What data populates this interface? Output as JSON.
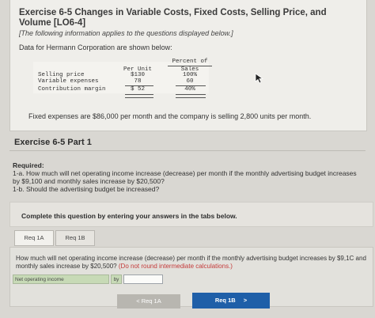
{
  "exercise": {
    "title": "Exercise 6-5 Changes in Variable Costs, Fixed Costs, Selling Price, and Volume [LO6-4]",
    "note": "[The following information applies to the questions displayed below.]",
    "intro": "Data for Hermann Corporation are shown below:",
    "table": {
      "col_per_unit": "Per Unit",
      "col_percent_of": "Percent of",
      "col_sales": "Sales",
      "rows": [
        {
          "label": "Selling price",
          "per_unit": "$130",
          "percent": "100%"
        },
        {
          "label": "Variable expenses",
          "per_unit": "78",
          "percent": "60"
        },
        {
          "label": "Contribution margin",
          "per_unit": "$ 52",
          "percent": "40%"
        }
      ]
    },
    "fixed_note": "Fixed expenses are $86,000 per month and the company is selling 2,800 units per month."
  },
  "part": {
    "title": "Exercise 6-5 Part 1",
    "required_label": "Required:",
    "required_1a": "1-a. How much will net operating income increase (decrease) per month if the monthly advertising budget increases by $9,100 and monthly sales increase by $20,500?",
    "required_1b": "1-b. Should the advertising budget be increased?"
  },
  "banner": {
    "text": "Complete this question by entering your answers in the tabs below."
  },
  "tabs": [
    {
      "label": "Req 1A",
      "active": true
    },
    {
      "label": "Req 1B",
      "active": false
    }
  ],
  "question": {
    "text": "How much will net operating income increase (decrease) per month if the monthly advertising budget increases by $9,1C and monthly sales increase by $20,500?",
    "hint": "(Do not round intermediate calculations.)",
    "answer_label": "Net operating income",
    "by_label": "by",
    "answer_value": ""
  },
  "nav": {
    "prev_label": "< Req 1A",
    "next_label": "Req 1B",
    "next_arrow": ">"
  },
  "colors": {
    "accent": "#1f5fa8",
    "hint_red": "#c43a3a",
    "answer_green": "#c7dab6"
  }
}
